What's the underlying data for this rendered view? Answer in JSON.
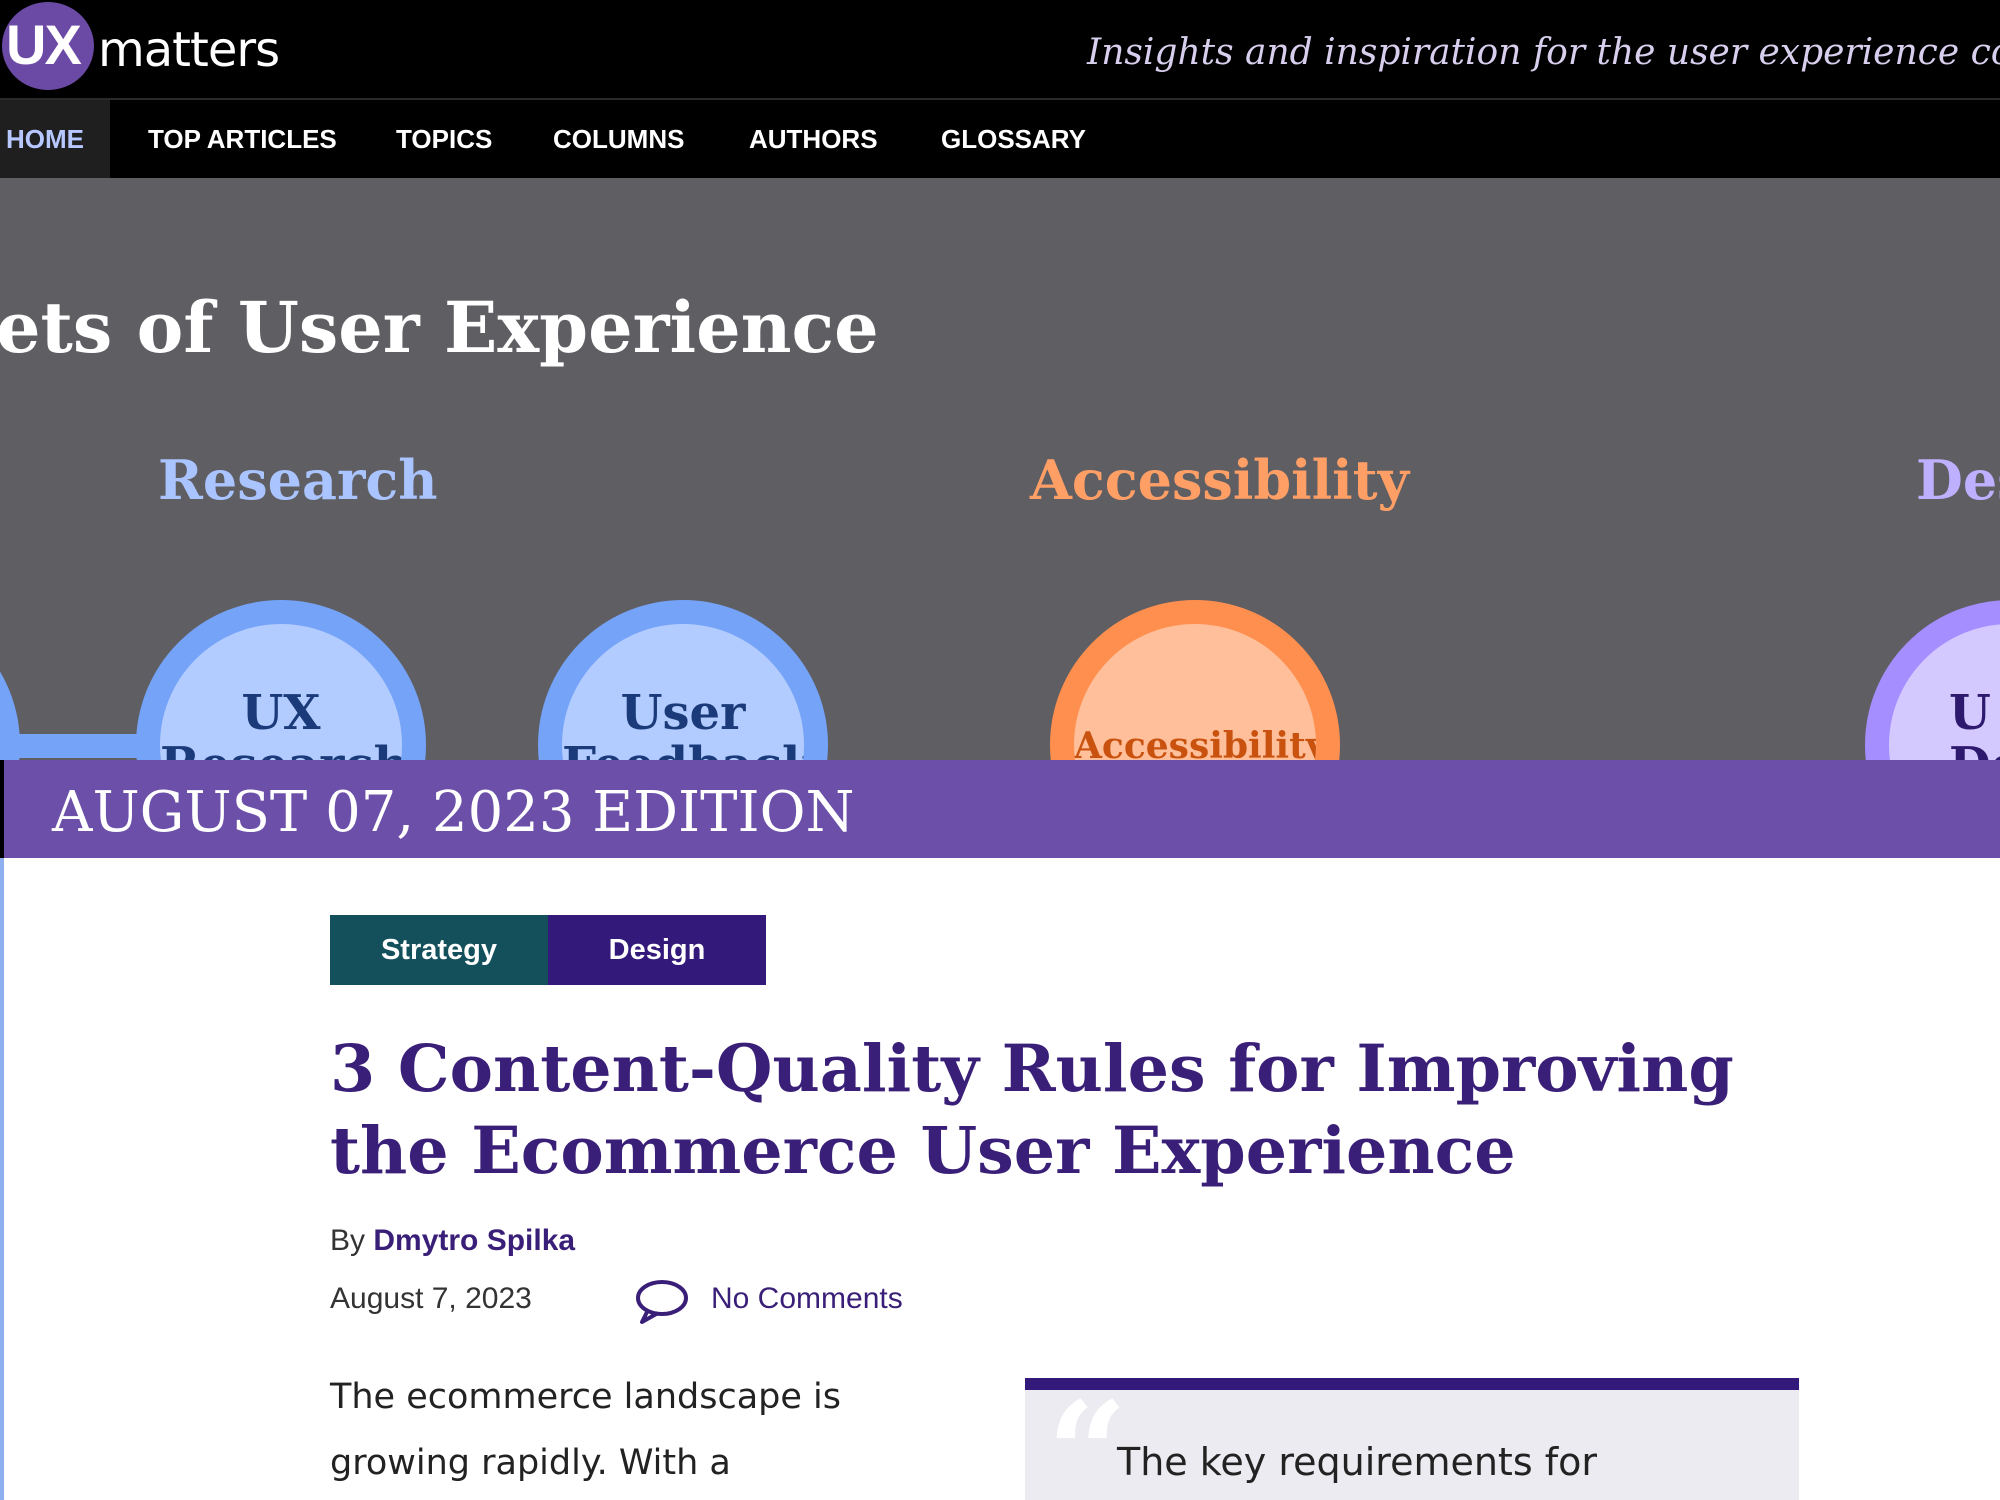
{
  "header": {
    "logo_ux": "UX",
    "logo_matters": "matters",
    "tagline": "Insights and inspiration for the user experience commu"
  },
  "nav": {
    "items": [
      {
        "label": "HOME",
        "active": true
      },
      {
        "label": "TOP ARTICLES"
      },
      {
        "label": "TOPICS"
      },
      {
        "label": "COLUMNS"
      },
      {
        "label": "AUTHORS"
      },
      {
        "label": "GLOSSARY"
      }
    ]
  },
  "hero": {
    "title": "ets of User Experience",
    "categories": [
      {
        "label": "Research",
        "color": "#a9c4ff"
      },
      {
        "label": "Accessibility",
        "color": "#ff9f66"
      },
      {
        "label": "Des",
        "color": "#bfb0ff"
      }
    ],
    "bubbles": [
      {
        "line1": "UX",
        "line2": "Research"
      },
      {
        "line1": "User",
        "line2": "Feedback"
      },
      {
        "line1": "Accessibility"
      },
      {
        "line1": "U",
        "line2": "De"
      }
    ]
  },
  "edition": {
    "label": "AUGUST 07, 2023 EDITION"
  },
  "article": {
    "tags": [
      "Strategy",
      "Design"
    ],
    "title": "3 Content-Quality Rules for Improving the Ecommerce User Experience",
    "by_label": "By",
    "author": "Dmytro Spilka",
    "date": "August 7, 2023",
    "comments": "No Comments",
    "body_line1": "The ecommerce landscape is",
    "body_line2": "growing rapidly. With a",
    "pullquote": "The key requirements for"
  },
  "colors": {
    "brand_purple": "#6b4fa9",
    "dark_purple": "#33197a",
    "teal": "#14505c",
    "hero_bg": "#5f5e63"
  }
}
